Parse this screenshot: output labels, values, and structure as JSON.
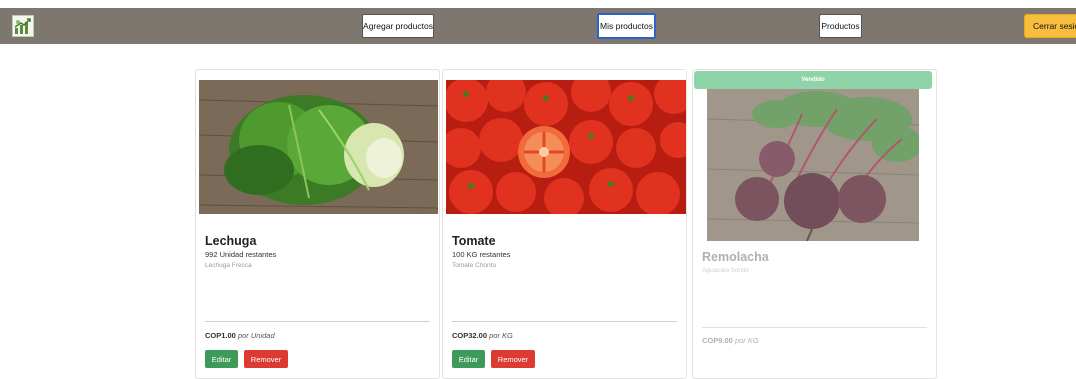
{
  "navbar": {
    "logo_icon": "plant-growth-icon",
    "add_products": "Agregar productos",
    "my_products": "Mis productos",
    "products": "Productos",
    "logout": "Cerrar sesión"
  },
  "products": [
    {
      "name": "Lechuga",
      "stock": "992 Unidad restantes",
      "description": "Lechuga Fresca",
      "price": "COP1.00",
      "unit": "por Unidad",
      "edit_label": "Editar",
      "remove_label": "Remover",
      "image_icon": "lettuce-image"
    },
    {
      "name": "Tomate",
      "stock": "100 KG restantes",
      "description": "Tomate Chonto",
      "price": "COP32.00",
      "unit": "por KG",
      "edit_label": "Editar",
      "remove_label": "Remover",
      "image_icon": "tomato-image"
    },
    {
      "name": "Remolacha",
      "badge": "Vendido",
      "description": "Aguacate bonito",
      "price": "COP9.00",
      "unit": "por KG",
      "image_icon": "beet-image"
    }
  ],
  "colors": {
    "navbar": "#7e7770",
    "edit": "#3e9a58",
    "remove": "#dc3b33",
    "sold_badge": "#8fd3a9",
    "logout": "#f6be3c",
    "active_outline": "#2d63c8"
  }
}
